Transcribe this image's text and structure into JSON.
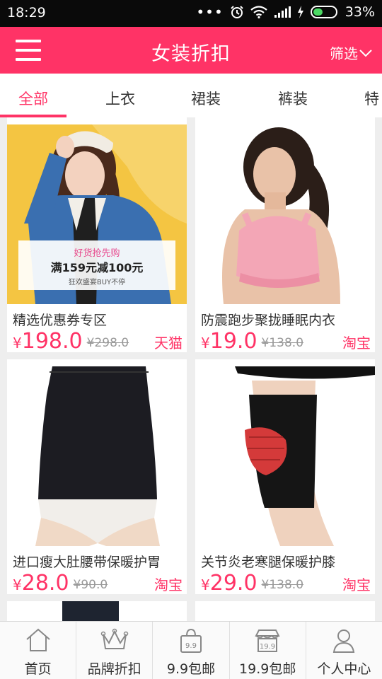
{
  "status": {
    "time": "18:29",
    "battery": "33%"
  },
  "header": {
    "title": "女装折扣",
    "filter_label": "筛选"
  },
  "tabs": [
    {
      "label": "全部",
      "active": true
    },
    {
      "label": "上衣",
      "active": false
    },
    {
      "label": "裙装",
      "active": false
    },
    {
      "label": "裤装",
      "active": false
    },
    {
      "label": "特",
      "active": false
    }
  ],
  "products": [
    {
      "title": "精选优惠券专区",
      "yen": "¥",
      "price": "198.0",
      "old_price": "¥298.0",
      "shop": "天猫"
    },
    {
      "title": "防震跑步聚拢睡眠内衣",
      "yen": "¥",
      "price": "19.0",
      "old_price": "¥138.0",
      "shop": "淘宝"
    },
    {
      "title": "进口瘦大肚腰带保暖护胃",
      "yen": "¥",
      "price": "28.0",
      "old_price": "¥90.0",
      "shop": "淘宝"
    },
    {
      "title": "关节炎老寒腿保暖护膝",
      "yen": "¥",
      "price": "29.0",
      "old_price": "¥138.0",
      "shop": "淘宝"
    }
  ],
  "banner": {
    "line1": "好货抢先购",
    "line2": "满159元减100元",
    "line3": "狂欢盛宴BUY不停"
  },
  "bottom_nav": [
    {
      "label": "首页",
      "icon": "home-icon"
    },
    {
      "label": "品牌折扣",
      "icon": "crown-icon"
    },
    {
      "label": "9.9包邮",
      "icon": "bag-icon",
      "badge": "9.9"
    },
    {
      "label": "19.9包邮",
      "icon": "store-icon",
      "badge": "19.9"
    },
    {
      "label": "个人中心",
      "icon": "user-icon"
    }
  ],
  "colors": {
    "accent": "#ff3366",
    "status_bar": "#0a0a0a"
  }
}
